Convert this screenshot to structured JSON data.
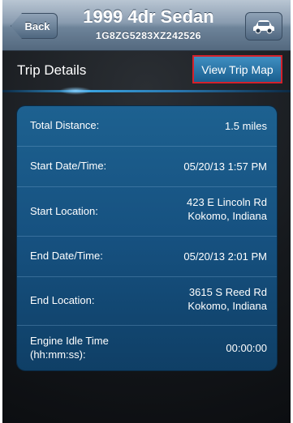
{
  "navbar": {
    "back_label": "Back",
    "title": "1999 4dr Sedan",
    "subtitle": "1G8ZG5283XZ242526",
    "vehicle_icon": "car-icon"
  },
  "section": {
    "title": "Trip Details",
    "map_button_label": "View Trip Map"
  },
  "details": [
    {
      "label": "Total Distance:",
      "value": "1.5 miles"
    },
    {
      "label": "Start Date/Time:",
      "value": "05/20/13 1:57 PM"
    },
    {
      "label": "Start Location:",
      "value_line1": "423 E Lincoln Rd",
      "value_line2": "Kokomo, Indiana"
    },
    {
      "label": "End Date/Time:",
      "value": "05/20/13 2:01 PM"
    },
    {
      "label": "End Location:",
      "value_line1": "3615 S Reed Rd",
      "value_line2": "Kokomo, Indiana"
    },
    {
      "label_line1": "Engine Idle Time",
      "label_line2": "(hh:mm:ss):",
      "value": "00:00:00"
    }
  ],
  "colors": {
    "accent": "#1d6190",
    "highlight": "#d4212b"
  }
}
